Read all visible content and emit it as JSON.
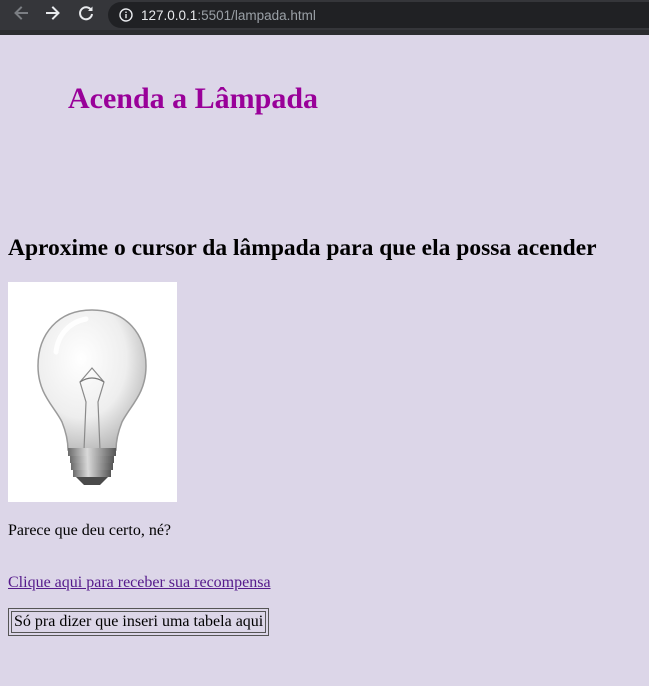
{
  "browser": {
    "url_host": "127.0.0.1",
    "url_rest": ":5501/lampada.html",
    "icons": [
      "arrow-left-icon",
      "arrow-right-icon",
      "reload-icon",
      "info-icon"
    ]
  },
  "page": {
    "title": "Acenda a Lâmpada",
    "instruction": "Aproxime o cursor da lâmpada para que ela possa acender",
    "paragraph": "Parece que deu certo, né?",
    "link_label": "Clique aqui para receber sua recompensa",
    "table_cell": "Só pra dizer que inseri uma tabela aqui",
    "colors": {
      "background": "#dcd6e8",
      "title": "#990099",
      "link": "#551a8b"
    }
  }
}
